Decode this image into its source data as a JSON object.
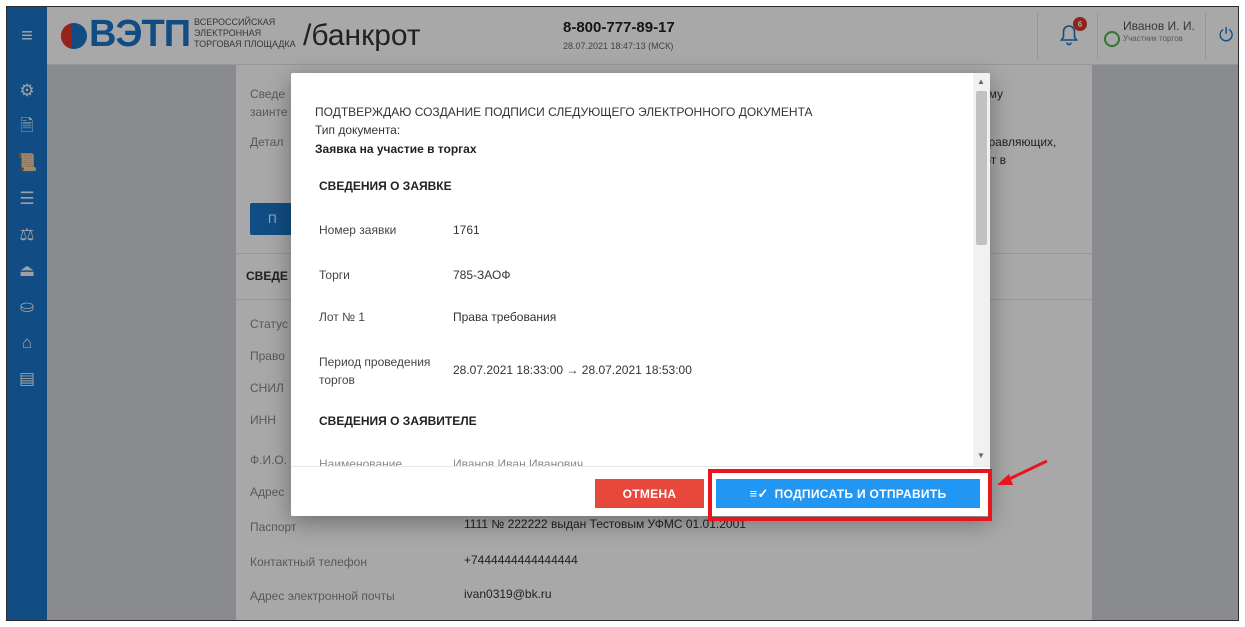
{
  "header": {
    "logo_text": "ВЭТП",
    "logo_sub": [
      "ВСЕРОССИЙСКАЯ",
      "ЭЛЕКТРОННАЯ",
      "ТОРГОВАЯ ПЛОЩАДКА"
    ],
    "section": "/банкрот",
    "phone": "8-800-777-89-17",
    "datetime": "28.07.2021 18:47:13 (МСК)",
    "notifications_count": "6",
    "user_name": "Иванов И. И.",
    "user_role": "Участник торгов",
    "hamburger_icon": "menu-icon",
    "power_icon": "power-icon"
  },
  "sidebar": {
    "items": [
      {
        "icon": "gear-icon"
      },
      {
        "icon": "document-icon"
      },
      {
        "icon": "scroll-icon"
      },
      {
        "icon": "list-icon"
      },
      {
        "icon": "gavel-icon"
      },
      {
        "icon": "auction-icon"
      },
      {
        "icon": "bid-icon"
      },
      {
        "icon": "bank-icon"
      },
      {
        "icon": "registry-icon"
      }
    ]
  },
  "background": {
    "rows": [
      {
        "label": "Паспорт",
        "value": "1111 № 222222 выдан Тестовым УФМС 01.01.2001"
      },
      {
        "label": "Контактный телефон",
        "value": "+7444444444444444"
      },
      {
        "label": "Адрес электронной почты",
        "value": "ivan0319@bk.ru"
      }
    ]
  },
  "modal": {
    "title": "ПОДТВЕРЖДАЮ СОЗДАНИЕ ПОДПИСИ СЛЕДУЮЩЕГО ЭЛЕКТРОННОГО ДОКУМЕНТА",
    "doc_type_label": "Тип документа:",
    "doc_type_value": "Заявка на участие в торгах",
    "section_application": "СВЕДЕНИЯ О ЗАЯВКЕ",
    "fields": [
      {
        "label": "Номер заявки",
        "value": "1761"
      },
      {
        "label": "Торги",
        "value": "785-ЗАОФ"
      },
      {
        "label": "Лот № 1",
        "value": "Права требования"
      },
      {
        "label": "Период проведения торгов",
        "value": "28.07.2021 18:33:00 → 28.07.2021 18:53:00"
      }
    ],
    "section_applicant": "СВЕДЕНИЯ О ЗАЯВИТЕЛЕ",
    "cancel_label": "ОТМЕНА",
    "sign_label": "ПОДПИСАТЬ И ОТПРАВИТЬ",
    "sign_icon": "sign-list-icon"
  },
  "colors": {
    "primary": "#1b75c9",
    "cancel": "#e8473c",
    "sign": "#2196f3",
    "annotation": "#e8141e"
  }
}
